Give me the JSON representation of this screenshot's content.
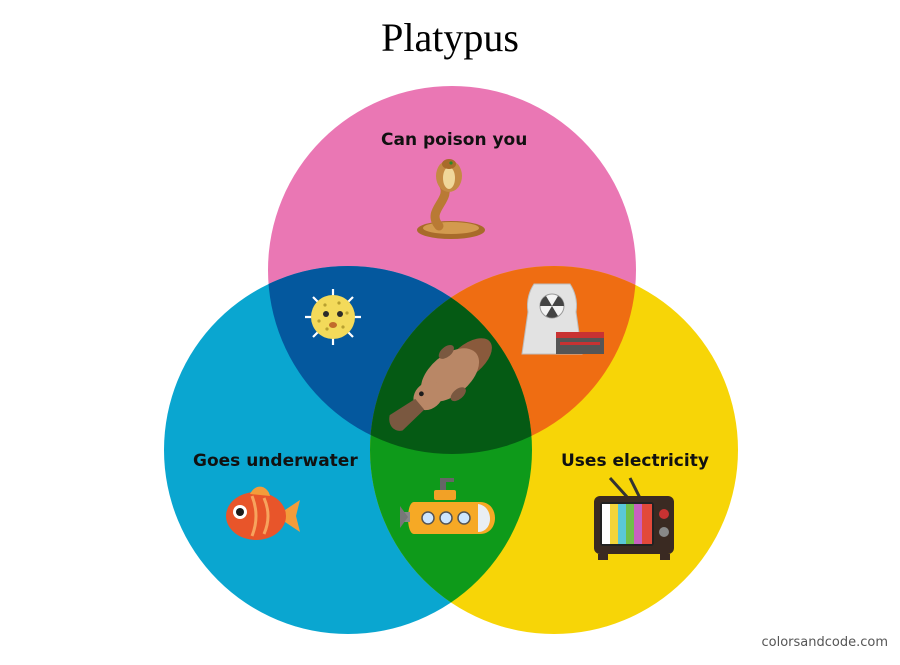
{
  "title": "Platypus",
  "sets": [
    {
      "label": "Can poison you",
      "color": "#ea77b4",
      "icon": "cobra-icon"
    },
    {
      "label": "Goes underwater",
      "color": "#0aa6d0",
      "icon": "fish-icon"
    },
    {
      "label": "Uses electricity",
      "color": "#f7d507",
      "icon": "television-icon"
    }
  ],
  "intersections": {
    "poison_underwater": {
      "color": "#04589e",
      "icon": "pufferfish-icon"
    },
    "poison_electricity": {
      "color": "#ef6d12",
      "icon": "nuclear-plant-icon"
    },
    "underwater_electricity": {
      "color": "#0e9a1a",
      "icon": "submarine-icon"
    },
    "all_three": {
      "color": "#055a14",
      "icon": "platypus-icon"
    }
  },
  "watermark": "colorsandcode.com"
}
